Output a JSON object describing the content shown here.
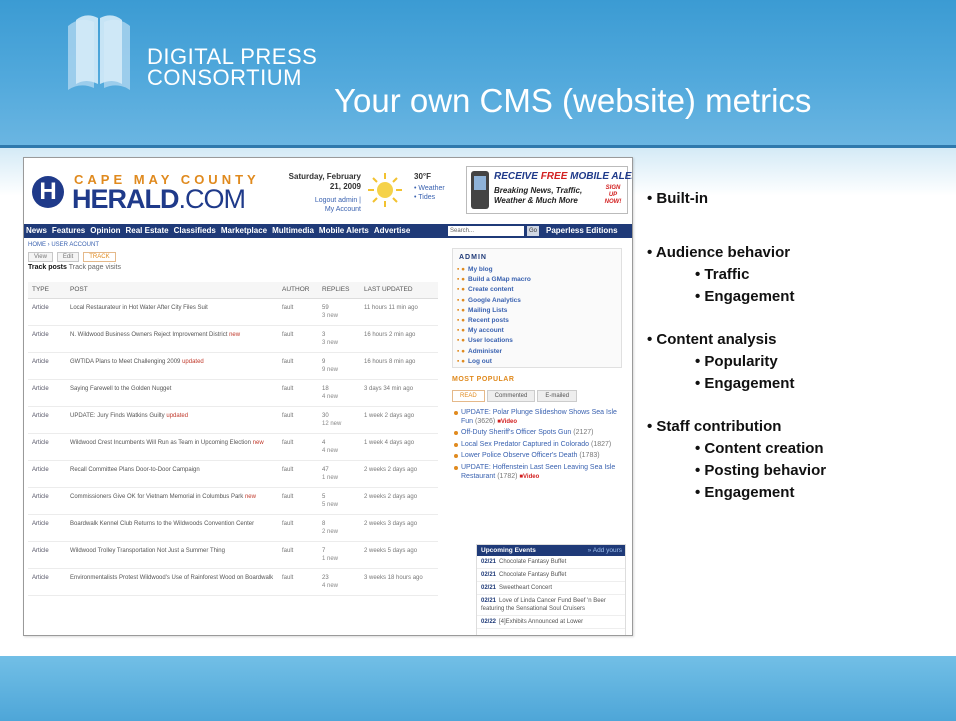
{
  "slide": {
    "logo_line1": "DIGITAL PRESS",
    "logo_line2": "CONSORTIUM",
    "title": "Your own CMS (website) metrics",
    "colors": {
      "header": "#52a9dc",
      "footer": "#5aaedc",
      "title_text": "#ffffff"
    }
  },
  "screenshot": {
    "site": {
      "logo_top": "CAPE MAY COUNTY",
      "logo_main_bold": "HERALD",
      "logo_main_light": ".COM",
      "logo_icon": "H",
      "date_line1": "Saturday, February",
      "date_line2": "21, 2009",
      "logout": "Logout admin |",
      "my_account": "My Account",
      "temperature": "30°F",
      "weather_link": "• Weather",
      "tides_link": "• Tides",
      "ad_line1_a": "RECEIVE ",
      "ad_line1_b": "FREE",
      "ad_line1_c": " MOBILE ALERTS",
      "ad_line2": "Breaking News, Traffic,",
      "ad_line3": "Weather & Much More",
      "ad_signup": "SIGN UP NOW!"
    },
    "nav": {
      "items": [
        "News",
        "Features",
        "Opinion",
        "Real Estate",
        "Classifieds",
        "Marketplace",
        "Multimedia",
        "Mobile Alerts",
        "Advertise"
      ],
      "search_placeholder": "Search...",
      "go": "Go",
      "paperless": "Paperless Editions"
    },
    "breadcrumb": "HOME › USER ACCOUNT",
    "tabs": [
      "View",
      "Edit",
      "TRACK"
    ],
    "subtabs": {
      "current": "Track posts",
      "other": " Track page visits"
    },
    "table": {
      "headers": [
        "TYPE",
        "POST",
        "AUTHOR",
        "REPLIES",
        "LAST UPDATED"
      ],
      "rows": [
        {
          "type": "Article",
          "post": "Local Restaurateur in Hot Water After City Files Suit",
          "flag": "",
          "author": "fault",
          "replies": "59",
          "new": "3 new",
          "updated": "11 hours 11 min ago"
        },
        {
          "type": "Article",
          "post": "N. Wildwood Business Owners Reject Improvement District",
          "flag": "new",
          "author": "fault",
          "replies": "3",
          "new": "3 new",
          "updated": "16 hours 2 min ago"
        },
        {
          "type": "Article",
          "post": "GWTIDA Plans to Meet Challenging 2009",
          "flag": "updated",
          "author": "fault",
          "replies": "9",
          "new": "9 new",
          "updated": "16 hours 8 min ago"
        },
        {
          "type": "Article",
          "post": "Saying Farewell to the Golden Nugget",
          "flag": "",
          "author": "fault",
          "replies": "18",
          "new": "4 new",
          "updated": "3 days 34 min ago"
        },
        {
          "type": "Article",
          "post": "UPDATE: Jury Finds Watkins Guilty",
          "flag": "updated",
          "author": "fault",
          "replies": "30",
          "new": "12 new",
          "updated": "1 week 2 days ago"
        },
        {
          "type": "Article",
          "post": "Wildwood Crest Incumbents Will Run as Team in Upcoming Election",
          "flag": "new",
          "author": "fault",
          "replies": "4",
          "new": "4 new",
          "updated": "1 week 4 days ago"
        },
        {
          "type": "Article",
          "post": "Recall Committee Plans Door-to-Door Campaign",
          "flag": "",
          "author": "fault",
          "replies": "47",
          "new": "1 new",
          "updated": "2 weeks 2 days ago"
        },
        {
          "type": "Article",
          "post": "Commissioners Give OK for Vietnam Memorial in Columbus Park",
          "flag": "new",
          "author": "fault",
          "replies": "5",
          "new": "5 new",
          "updated": "2 weeks 2 days ago"
        },
        {
          "type": "Article",
          "post": "Boardwalk Kennel Club Returns to the Wildwoods Convention Center",
          "flag": "",
          "author": "fault",
          "replies": "8",
          "new": "2 new",
          "updated": "2 weeks 3 days ago"
        },
        {
          "type": "Article",
          "post": "Wildwood Trolley Transportation Not Just a Summer Thing",
          "flag": "",
          "author": "fault",
          "replies": "7",
          "new": "1 new",
          "updated": "2 weeks 5 days ago"
        },
        {
          "type": "Article",
          "post": "Environmentalists Protest Wildwood's Use of Rainforest Wood on Boardwalk",
          "flag": "",
          "author": "fault",
          "replies": "23",
          "new": "4 new",
          "updated": "3 weeks 18 hours ago"
        }
      ]
    },
    "admin": {
      "title": "ADMIN",
      "items": [
        "My blog",
        "Build a GMap macro",
        "Create content",
        "Google Analytics",
        "Mailing Lists",
        "Recent posts",
        "My account",
        "User locations",
        "Administer",
        "Log out"
      ]
    },
    "popular": {
      "title": "MOST POPULAR",
      "tabs": [
        "READ",
        "Commented",
        "E-mailed"
      ],
      "items": [
        {
          "text": "UPDATE: Polar Plunge Slideshow Shows Sea Isle Fun",
          "count": "(3626)",
          "video": "Video"
        },
        {
          "text": "Off-Duty Sheriff's Officer Spots Gun",
          "count": "(2127)",
          "video": ""
        },
        {
          "text": "Local Sex Predator Captured in Colorado",
          "count": "(1827)",
          "video": ""
        },
        {
          "text": "Lower Police Observe Officer's Death",
          "count": "(1783)",
          "video": ""
        },
        {
          "text": "UPDATE: Hoffenstein Last Seen Leaving Sea Isle Restaurant",
          "count": "(1782)",
          "video": "Video"
        }
      ]
    },
    "events": {
      "title": "Upcoming Events",
      "add": "» Add yours",
      "items": [
        {
          "date": "02/21",
          "text": "Chocolate Fantasy Buffet"
        },
        {
          "date": "02/21",
          "text": "Chocolate Fantasy Buffet"
        },
        {
          "date": "02/21",
          "text": "Sweetheart Concert"
        },
        {
          "date": "02/21",
          "text": "Love of Linda Cancer Fund Beef 'n Beer featuring the Sensational Soul Cruisers"
        },
        {
          "date": "02/22",
          "text": "[4]Exhibits Announced at Lower"
        }
      ]
    }
  },
  "bullets": [
    {
      "level": 1,
      "text": "• Built-in"
    },
    {
      "level": 1,
      "text": "• Audience behavior"
    },
    {
      "level": 2,
      "text": "• Traffic"
    },
    {
      "level": 2,
      "text": "• Engagement"
    },
    {
      "level": 1,
      "text": "• Content analysis"
    },
    {
      "level": 2,
      "text": "• Popularity"
    },
    {
      "level": 2,
      "text": "• Engagement"
    },
    {
      "level": 1,
      "text": "• Staff contribution"
    },
    {
      "level": 2,
      "text": "• Content creation"
    },
    {
      "level": 2,
      "text": "• Posting behavior"
    },
    {
      "level": 2,
      "text": "• Engagement"
    }
  ]
}
